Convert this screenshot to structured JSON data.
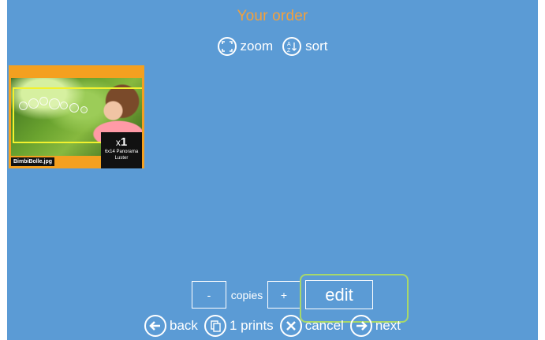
{
  "page": {
    "title": "Your order",
    "background_color": "#5b9bd5",
    "title_color": "#f2a03d"
  },
  "top_toolbar": {
    "zoom": {
      "label": "zoom",
      "icon": "zoom-frame-icon"
    },
    "sort": {
      "label": "sort",
      "icon": "sort-az-icon"
    }
  },
  "order_items": [
    {
      "filename": "BimbiBolle.jpg",
      "quantity": "1",
      "quantity_prefix": "x",
      "format": "6x14 Panorama",
      "finish": "Luster",
      "highlight_color": "#f4a020",
      "crop_color": "#f2f22e"
    }
  ],
  "controls": {
    "minus_label": "-",
    "copies_label": "copies",
    "plus_label": "+",
    "edit_label": "edit",
    "highlight_color": "#a8d86a"
  },
  "bottom_toolbar": {
    "back": {
      "label": "back",
      "icon": "arrow-left-icon"
    },
    "prints": {
      "label": "1 prints",
      "icon": "prints-icon"
    },
    "cancel": {
      "label": "cancel",
      "icon": "close-icon"
    },
    "next": {
      "label": "next",
      "icon": "arrow-right-icon"
    }
  }
}
